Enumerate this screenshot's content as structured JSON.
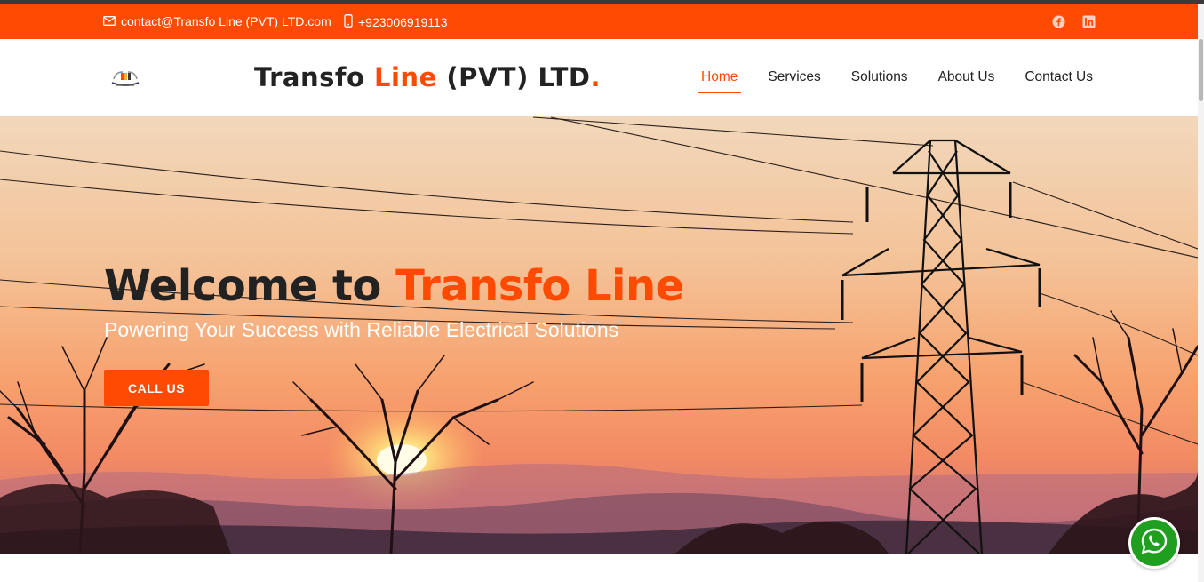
{
  "topbar": {
    "email": "contact@Transfo Line (PVT) LTD.com",
    "phone": "+923006919113",
    "social": [
      "facebook-icon",
      "linkedin-icon"
    ],
    "background": "#fe4a03"
  },
  "header": {
    "brand_part1": "Transfo ",
    "brand_part2": "Line",
    "brand_part3": " (PVT) LTD",
    "brand_dot": ".",
    "nav": [
      {
        "label": "Home",
        "active": true
      },
      {
        "label": "Services",
        "active": false
      },
      {
        "label": "Solutions",
        "active": false
      },
      {
        "label": "About Us",
        "active": false
      },
      {
        "label": "Contact Us",
        "active": false
      }
    ]
  },
  "hero": {
    "title_part1": "Welcome to ",
    "title_part2": "Transfo Line",
    "subtitle": "Powering Your Success with Reliable Electrical Solutions",
    "cta": "CALL US"
  },
  "floating": {
    "icon": "whatsapp-icon",
    "color": "#1f9e1f"
  },
  "colors": {
    "accent": "#fe4a03",
    "dark_text": "#222222"
  }
}
